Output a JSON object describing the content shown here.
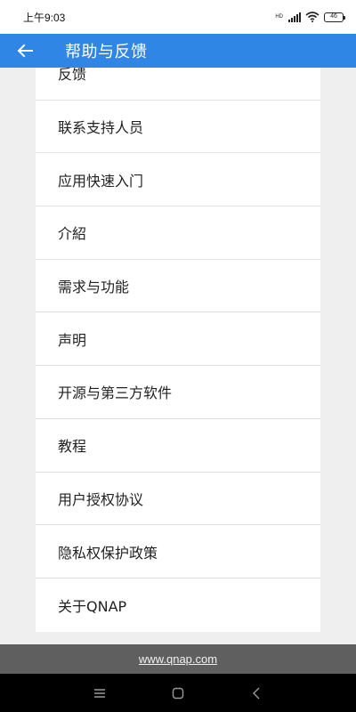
{
  "status_bar": {
    "time": "上午9:03",
    "network_label": "HD",
    "battery": "46"
  },
  "app_bar": {
    "title": "帮助与反馈",
    "back_icon": "arrow-left-icon",
    "background": "#2f86e4"
  },
  "list": {
    "items": [
      "反馈",
      "联系支持人员",
      "应用快速入门",
      "介紹",
      "需求与功能",
      "声明",
      "开源与第三方软件",
      "教程",
      "用户授权协议",
      "隐私权保护政策",
      "关于QNAP"
    ]
  },
  "footer": {
    "link": "www.qnap.com"
  },
  "nav_bar": {
    "icons": [
      "menu-icon",
      "home-icon",
      "back-icon"
    ]
  }
}
